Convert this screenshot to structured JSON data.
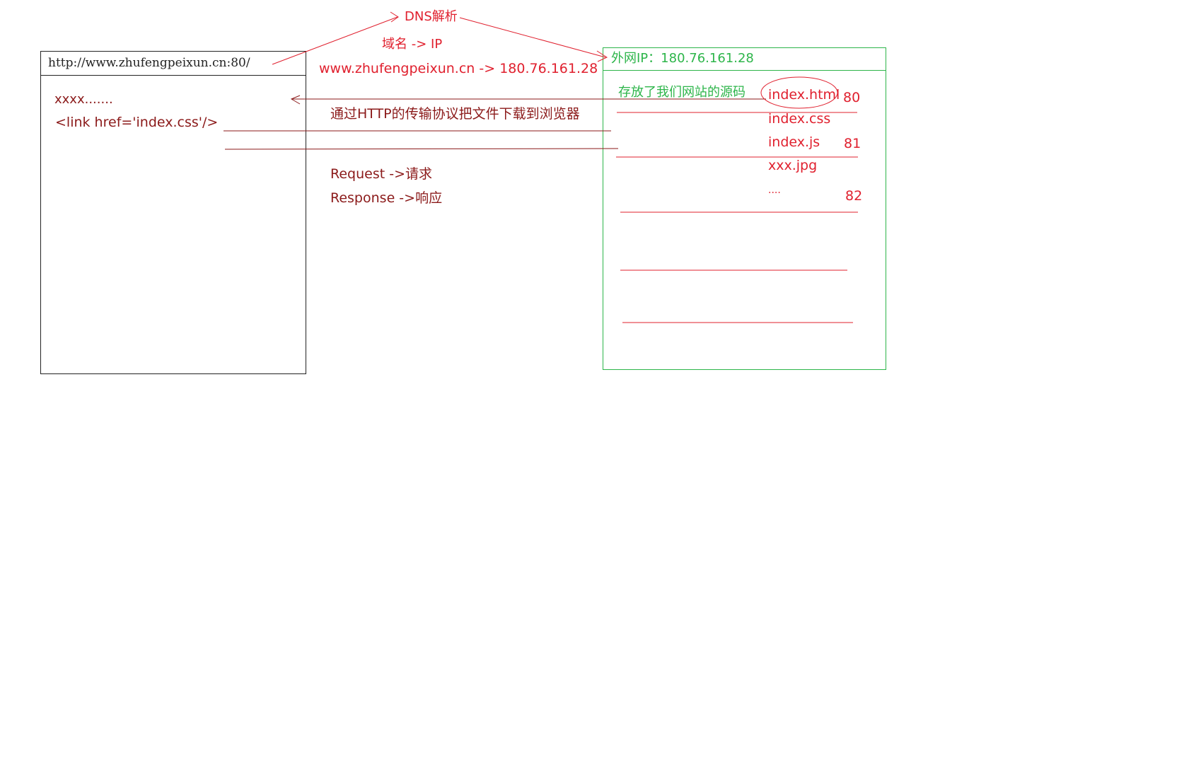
{
  "browser": {
    "url": "http://www.zhufengpeixun.cn:80/",
    "content_line1": "xxxx.......",
    "content_line2": "<link href='index.css'/>"
  },
  "dns": {
    "title": "DNS解析",
    "mapping_label": "域名 -> IP",
    "mapping_example": "www.zhufengpeixun.cn -> 180.76.161.28"
  },
  "transfer": {
    "description": "通过HTTP的传输协议把文件下载到浏览器",
    "request": "Request  ->请求",
    "response": "Response ->响应"
  },
  "server": {
    "header": "外网IP：180.76.161.28",
    "note": "存放了我们网站的源码",
    "files": [
      "index.html",
      "index.css",
      "index.js",
      "xxx.jpg",
      "...."
    ],
    "ports": [
      "80",
      "81",
      "82"
    ]
  },
  "colors": {
    "red": "#e0202e",
    "dark_red": "#8b1a1a",
    "green": "#2db54a",
    "black": "#222222"
  }
}
